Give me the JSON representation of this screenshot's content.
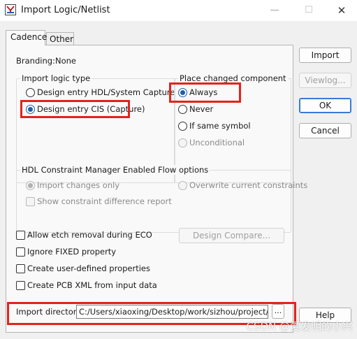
{
  "window": {
    "title": "Import Logic/Netlist",
    "minimize_symbol": "—",
    "maximize_symbol": "☐",
    "close_symbol": "✕"
  },
  "tabs": [
    {
      "label": "Cadence",
      "active": true
    },
    {
      "label": "Other",
      "active": false
    }
  ],
  "branding": {
    "label": "Branding:",
    "value": "None"
  },
  "import_logic_type": {
    "title": "Import logic type",
    "options": [
      {
        "label": "Design entry HDL/System Capture",
        "selected": false
      },
      {
        "label": "Design entry CIS (Capture)",
        "selected": true
      }
    ]
  },
  "place_changed": {
    "title": "Place changed component",
    "options": [
      {
        "label": "Always",
        "selected": true,
        "enabled": true
      },
      {
        "label": "Never",
        "selected": false,
        "enabled": true
      },
      {
        "label": "If same symbol",
        "selected": false,
        "enabled": true
      },
      {
        "label": "Unconditional",
        "selected": false,
        "enabled": false
      }
    ]
  },
  "hdl_constraint": {
    "title": "HDL Constraint Manager Enabled Flow options",
    "import_changes_only": "Import changes only",
    "overwrite_constraints": "Overwrite current constraints",
    "show_difference": "Show constraint difference report"
  },
  "options": {
    "allow_etch": "Allow etch removal during ECO",
    "ignore_fixed": "Ignore FIXED property",
    "create_user_props": "Create user-defined properties",
    "create_pcb_xml": "Create PCB XML from input data"
  },
  "design_compare_label": "Design Compare...",
  "import_directory": {
    "label": "Import directory:",
    "value": "C:/Users/xiaoxing/Desktop/work/sizhou/project/sch/allegro",
    "browse_label": "..."
  },
  "buttons": {
    "import": "Import",
    "viewlog": "Viewlog...",
    "ok": "OK",
    "cancel": "Cancel",
    "help": "Help"
  },
  "watermark": "CSDN @爱发明的小兴",
  "colors": {
    "highlight": "#e3231a",
    "radio_accent": "#1f5fa8",
    "default_button_border": "#3b7ad9"
  }
}
